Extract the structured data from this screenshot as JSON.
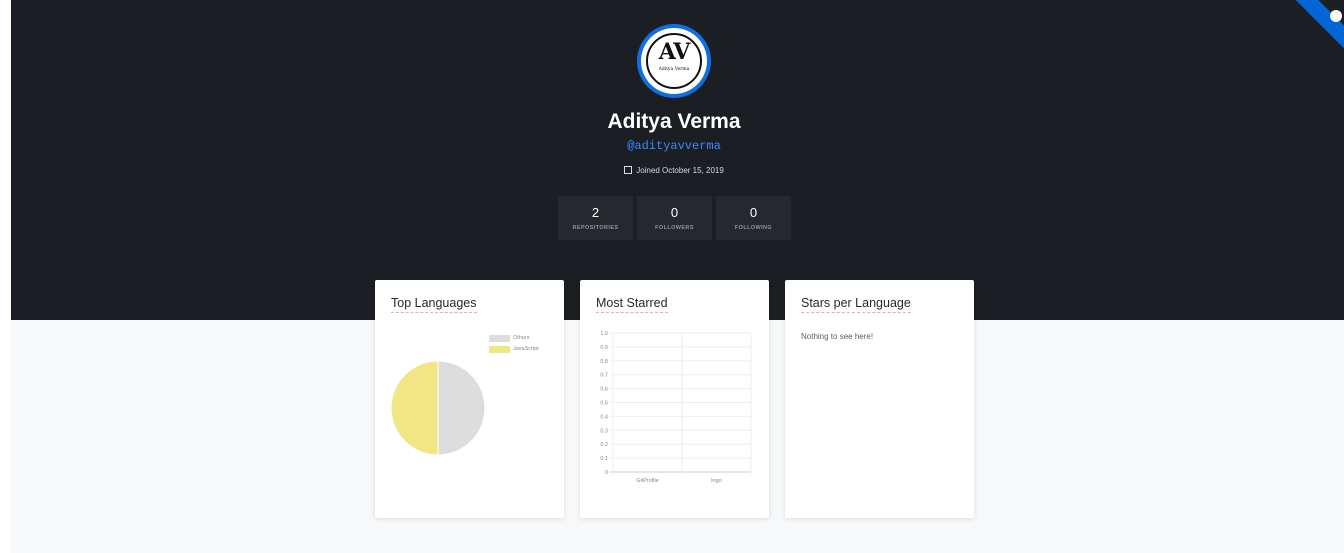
{
  "profile": {
    "avatar_initials": "AV",
    "avatar_subtext": "Aditya Verma",
    "name": "Aditya Verma",
    "handle": "@adityavverma",
    "joined": "Joined October 15, 2019"
  },
  "stats": [
    {
      "value": "2",
      "label": "REPOSITORIES"
    },
    {
      "value": "0",
      "label": "FOLLOWERS"
    },
    {
      "value": "0",
      "label": "FOLLOWING"
    }
  ],
  "cards": {
    "top_languages": {
      "title": "Top Languages"
    },
    "most_starred": {
      "title": "Most Starred"
    },
    "stars_per_language": {
      "title": "Stars per Language",
      "empty": "Nothing to see here!"
    }
  },
  "colors": {
    "accent": "#0366d6",
    "others": "#dddddd",
    "javascript": "#f1e686"
  },
  "icons": {
    "calendar": "calendar-icon",
    "corner": "github-octocat-icon"
  },
  "chart_data": [
    {
      "type": "pie",
      "labels": [
        "Others",
        "JavaScript"
      ],
      "values": [
        1,
        1
      ],
      "colors": [
        "#dddddd",
        "#f1e686"
      ],
      "legend": "top-right"
    },
    {
      "type": "bar",
      "categories": [
        "GitProfile",
        "logo"
      ],
      "values": [
        0,
        0
      ],
      "ylim": [
        0,
        1.0
      ],
      "yticks": [
        "1.0",
        "0.9",
        "0.8",
        "0.7",
        "0.6",
        "0.5",
        "0.4",
        "0.3",
        "0.2",
        "0.1",
        "0"
      ],
      "grid": true
    }
  ]
}
